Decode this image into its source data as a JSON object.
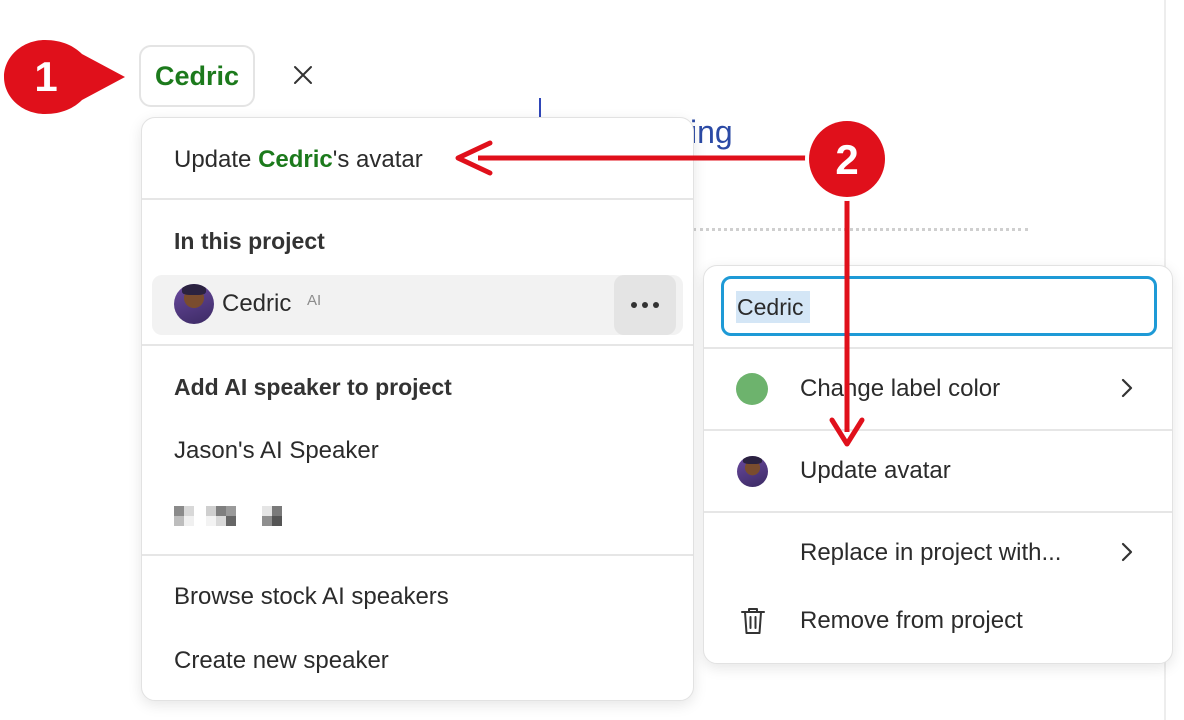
{
  "chip": {
    "label": "Cedric",
    "label_color": "#1c7a1c"
  },
  "background": {
    "partial_word": "ing"
  },
  "left_menu": {
    "update_avatar": {
      "prefix": "Update ",
      "name": "Cedric",
      "suffix": "'s avatar"
    },
    "in_project_heading": "In this project",
    "speaker": {
      "name": "Cedric",
      "badge": "AI"
    },
    "add_heading": "Add AI speaker to project",
    "add_items": [
      "Jason's AI Speaker"
    ],
    "browse": "Browse stock AI speakers",
    "create": "Create new speaker"
  },
  "right_menu": {
    "name_value": "Cedric",
    "change_color": "Change label color",
    "label_color": "#6db36d",
    "update_avatar": "Update avatar",
    "replace": "Replace in project with...",
    "remove": "Remove from project"
  },
  "annotations": {
    "step1": "1",
    "step2": "2",
    "badge_color": "#e0101b"
  },
  "icons": {
    "close": "close-icon",
    "more": "more-horizontal-icon",
    "chevron": "chevron-right-icon",
    "trash": "trash-icon"
  }
}
